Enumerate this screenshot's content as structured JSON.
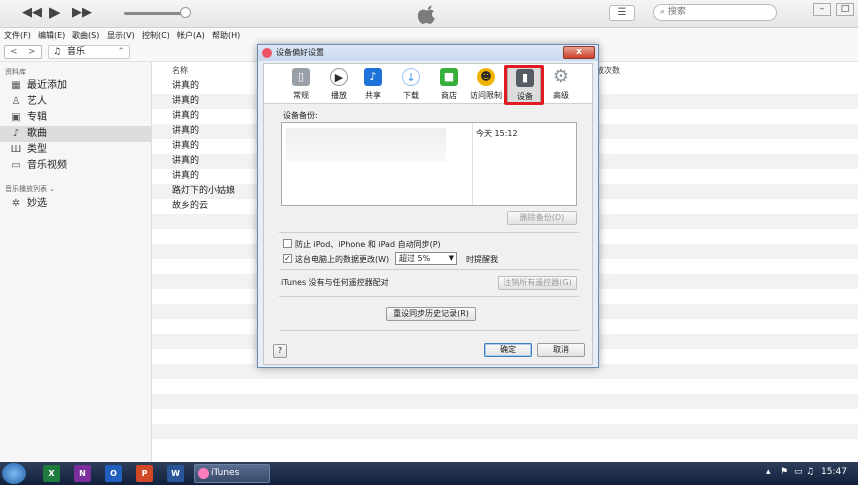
{
  "player": {
    "prev": "◀◀",
    "play": "▶",
    "next": "▶▶",
    "list_icon": "☰",
    "search_placeholder": "搜索",
    "window_minimize": "–",
    "window_restore": "□"
  },
  "menubar": [
    "文件(F)",
    "编辑(E)",
    "歌曲(S)",
    "显示(V)",
    "控制(C)",
    "帐户(A)",
    "帮助(H)"
  ],
  "nav": {
    "back": "<",
    "forward": ">",
    "media_icon": "♫",
    "media_label": "音乐",
    "media_arrow": "⌃"
  },
  "sidebar": {
    "library_header": "资料库",
    "library_items": [
      {
        "icon": "▦",
        "label": "最近添加"
      },
      {
        "icon": "♙",
        "label": "艺人"
      },
      {
        "icon": "▣",
        "label": "专辑"
      },
      {
        "icon": "♪",
        "label": "歌曲"
      },
      {
        "icon": "Ш",
        "label": "类型"
      },
      {
        "icon": "▭",
        "label": "音乐视频"
      }
    ],
    "playlists_header": "音乐播放列表 ⌄",
    "playlist_items": [
      {
        "icon": "✲",
        "label": "妙选"
      }
    ]
  },
  "main": {
    "col_name": "名称",
    "col_plays": "放次数",
    "rows": [
      "讲真的",
      "讲真的",
      "讲真的",
      "讲真的",
      "讲真的",
      "讲真的",
      "讲真的",
      "路灯下的小姑娘",
      "故乡的云"
    ]
  },
  "dialog": {
    "title": "设备偏好设置",
    "close": "x",
    "toolbar": [
      {
        "label": "常规",
        "icon": "▯",
        "color": "#9aa0a8"
      },
      {
        "label": "播放",
        "icon": "▶",
        "color": "#2b2b2b"
      },
      {
        "label": "共享",
        "icon": "♪",
        "color": "#1e73d8"
      },
      {
        "label": "下载",
        "icon": "↓",
        "color": "#3a8be0"
      },
      {
        "label": "商店",
        "icon": "■",
        "color": "#36b03a"
      },
      {
        "label": "访问限制",
        "icon": "☻",
        "color": "#f0b400"
      },
      {
        "label": "设备",
        "icon": "▮",
        "color": "#555b63"
      },
      {
        "label": "高级",
        "icon": "⚙",
        "color": "#8d949c"
      }
    ],
    "backups_label": "设备备份:",
    "backup_time": "今天 15:12",
    "delete_backup": "删除备份(D)",
    "prevent_sync_label": "防止 iPod、iPhone 和 iPad 自动同步(P)",
    "prevent_sync_checked": false,
    "warn_label": "这台电脑上的数据更改(W)",
    "warn_checked": true,
    "warn_prefix_check": "✓",
    "warn_option": "超过 5%",
    "warn_suffix": "时提醒我",
    "remotes_label": "iTunes 没有与任何遥控器配对",
    "forget_remotes": "注销所有遥控器(G)",
    "reset_history": "重设同步历史记录(R)",
    "help": "?",
    "ok": "确定",
    "cancel": "取消"
  },
  "taskbar": {
    "apps": [
      {
        "label": "X",
        "color": "#1f7a3d"
      },
      {
        "label": "N",
        "color": "#7a2f9c"
      },
      {
        "label": "O",
        "color": "#1f5fbf"
      },
      {
        "label": "P",
        "color": "#d24726"
      },
      {
        "label": "W",
        "color": "#2a5699"
      }
    ],
    "itunes_label": "iTunes",
    "clock": "15:47"
  }
}
